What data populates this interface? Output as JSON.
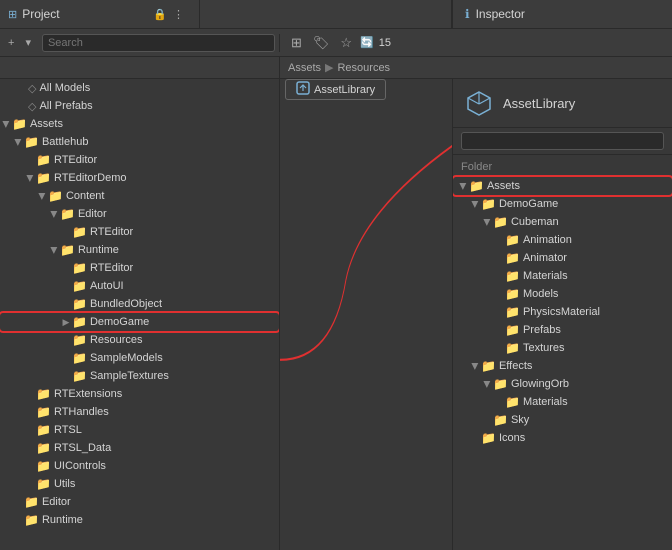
{
  "tabs": {
    "project": "Project",
    "inspector": "Inspector"
  },
  "toolbar": {
    "search_placeholder": "Search",
    "badge_count": "15"
  },
  "breadcrumb": {
    "part1": "Assets",
    "sep": "▶",
    "part2": "Resources"
  },
  "asset_library": {
    "label": "AssetLibrary"
  },
  "project_tree": {
    "items": [
      {
        "id": "all-models",
        "label": "All Models",
        "indent": 2,
        "has_arrow": false,
        "icon": false
      },
      {
        "id": "all-prefabs",
        "label": "All Prefabs",
        "indent": 2,
        "has_arrow": false,
        "icon": false
      },
      {
        "id": "assets",
        "label": "Assets",
        "indent": 0,
        "has_arrow": true,
        "expanded": true,
        "icon": true
      },
      {
        "id": "battlehub",
        "label": "Battlehub",
        "indent": 1,
        "has_arrow": true,
        "expanded": true,
        "icon": true
      },
      {
        "id": "rteditor1",
        "label": "RTEditor",
        "indent": 2,
        "has_arrow": false,
        "expanded": false,
        "icon": true
      },
      {
        "id": "rteditor-demo",
        "label": "RTEditorDemo",
        "indent": 2,
        "has_arrow": true,
        "expanded": true,
        "icon": true
      },
      {
        "id": "content",
        "label": "Content",
        "indent": 3,
        "has_arrow": true,
        "expanded": true,
        "icon": true
      },
      {
        "id": "editor1",
        "label": "Editor",
        "indent": 4,
        "has_arrow": true,
        "expanded": true,
        "icon": true
      },
      {
        "id": "rteditor2",
        "label": "RTEditor",
        "indent": 5,
        "has_arrow": false,
        "icon": true
      },
      {
        "id": "runtime",
        "label": "Runtime",
        "indent": 4,
        "has_arrow": true,
        "expanded": true,
        "icon": true
      },
      {
        "id": "rteditor3",
        "label": "RTEditor",
        "indent": 5,
        "has_arrow": false,
        "icon": true
      },
      {
        "id": "autoui",
        "label": "AutoUI",
        "indent": 5,
        "has_arrow": false,
        "icon": true
      },
      {
        "id": "bundled",
        "label": "BundledObject",
        "indent": 5,
        "has_arrow": false,
        "icon": true
      },
      {
        "id": "demogame",
        "label": "DemoGame",
        "indent": 5,
        "has_arrow": false,
        "icon": true,
        "highlighted": true
      },
      {
        "id": "resources",
        "label": "Resources",
        "indent": 5,
        "has_arrow": false,
        "icon": true
      },
      {
        "id": "samplemodels",
        "label": "SampleModels",
        "indent": 5,
        "has_arrow": false,
        "icon": true
      },
      {
        "id": "sampletextures",
        "label": "SampleTextures",
        "indent": 5,
        "has_arrow": false,
        "icon": true
      },
      {
        "id": "rtextensions",
        "label": "RTExtensions",
        "indent": 2,
        "has_arrow": false,
        "icon": true
      },
      {
        "id": "rthandles",
        "label": "RTHandles",
        "indent": 2,
        "has_arrow": false,
        "icon": true
      },
      {
        "id": "rtsl",
        "label": "RTSL",
        "indent": 2,
        "has_arrow": false,
        "icon": true
      },
      {
        "id": "rtsl-data",
        "label": "RTSL_Data",
        "indent": 2,
        "has_arrow": false,
        "icon": true
      },
      {
        "id": "uicontrols",
        "label": "UIControls",
        "indent": 2,
        "has_arrow": false,
        "icon": true
      },
      {
        "id": "utils",
        "label": "Utils",
        "indent": 2,
        "has_arrow": false,
        "icon": true
      },
      {
        "id": "editor2",
        "label": "Editor",
        "indent": 1,
        "has_arrow": false,
        "icon": true
      },
      {
        "id": "runtime2",
        "label": "Runtime",
        "indent": 1,
        "has_arrow": false,
        "icon": true
      }
    ]
  },
  "inspector": {
    "title": "AssetLibrary",
    "search_placeholder": "",
    "section_label": "Folder",
    "tree": [
      {
        "id": "assets-root",
        "label": "Assets",
        "indent": 0,
        "has_arrow": true,
        "expanded": true,
        "highlighted": true
      },
      {
        "id": "demogame-i",
        "label": "DemoGame",
        "indent": 1,
        "has_arrow": true,
        "expanded": true
      },
      {
        "id": "cubeman",
        "label": "Cubeman",
        "indent": 2,
        "has_arrow": true,
        "expanded": true
      },
      {
        "id": "animation",
        "label": "Animation",
        "indent": 3,
        "has_arrow": false
      },
      {
        "id": "animator",
        "label": "Animator",
        "indent": 3,
        "has_arrow": false
      },
      {
        "id": "materials",
        "label": "Materials",
        "indent": 3,
        "has_arrow": false
      },
      {
        "id": "models",
        "label": "Models",
        "indent": 3,
        "has_arrow": false
      },
      {
        "id": "physicsmaterial",
        "label": "PhysicsMaterial",
        "indent": 3,
        "has_arrow": false
      },
      {
        "id": "prefabs",
        "label": "Prefabs",
        "indent": 3,
        "has_arrow": false
      },
      {
        "id": "textures",
        "label": "Textures",
        "indent": 3,
        "has_arrow": false
      },
      {
        "id": "effects",
        "label": "Effects",
        "indent": 1,
        "has_arrow": true,
        "expanded": true
      },
      {
        "id": "glowingorb",
        "label": "GlowingOrb",
        "indent": 2,
        "has_arrow": true,
        "expanded": true
      },
      {
        "id": "materials2",
        "label": "Materials",
        "indent": 3,
        "has_arrow": false
      },
      {
        "id": "sky",
        "label": "Sky",
        "indent": 2,
        "has_arrow": false
      },
      {
        "id": "icons",
        "label": "Icons",
        "indent": 1,
        "has_arrow": false
      }
    ]
  },
  "colors": {
    "accent": "#e03030",
    "folder": "#c8a84a",
    "selection": "#2d5a8e",
    "bg": "#383838"
  }
}
